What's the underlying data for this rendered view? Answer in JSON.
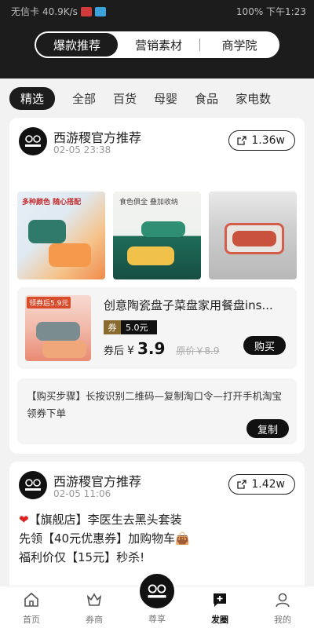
{
  "status_bar": {
    "carrier": "无信卡",
    "speed": "40.9K/s",
    "right": "100% 下午1:23"
  },
  "top_tabs": [
    "爆款推荐",
    "营销素材",
    "商学院"
  ],
  "categories": [
    "精选",
    "全部",
    "百货",
    "母婴",
    "食品",
    "家电数"
  ],
  "post1": {
    "author": "西游稷官方推荐",
    "time": "02-05 23:38",
    "shares": "1.36w",
    "image_captions": [
      "多种颜色 随心搭配",
      "食色俱全 叠加收纳"
    ],
    "product": {
      "thumb_tag": "领券后5.9元",
      "title": "创意陶瓷盘子菜盘家用餐盘ins...",
      "coupon_label": "券",
      "coupon_value": "5.0元",
      "after_label": "券后",
      "currency": "¥",
      "price": "3.9",
      "original": "原价￥8.9",
      "buy_label": "购买"
    },
    "steps_text": "【购买步骤】长按识别二维码—复制淘口令—打开手机淘宝领券下单",
    "copy_label": "复制"
  },
  "post2": {
    "author": "西游稷官方推荐",
    "time": "02-05 11:06",
    "shares": "1.42w",
    "lines": [
      "【旗舰店】李医生去黑头套装",
      "先领【40元优惠券】加购物车👜",
      "福利价仅【15元】秒杀!"
    ]
  },
  "nav": [
    "首页",
    "券商",
    "尊享",
    "发圈",
    "我的"
  ]
}
